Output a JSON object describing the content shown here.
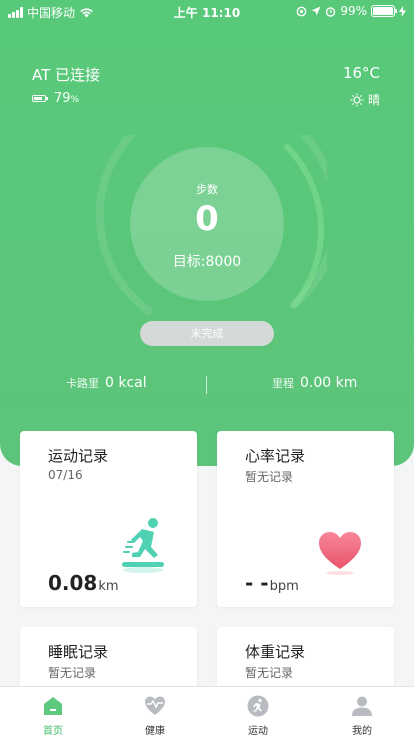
{
  "status_bar": {
    "carrier": "中国移动",
    "time": "上午 11:10",
    "battery_percent": "99%",
    "battery_level": 0.99,
    "icons": [
      "signal-icon",
      "wifi-icon",
      "location-icon",
      "navigation-icon",
      "alarm-icon",
      "battery-icon",
      "charging-icon"
    ]
  },
  "header": {
    "connection_status": "AT 已连接",
    "temperature": "16°C",
    "device_battery_value": "79",
    "device_battery_unit": "%",
    "device_battery_level": 0.79,
    "weather": "晴"
  },
  "steps": {
    "label": "步数",
    "value": "0",
    "goal_text": "目标:8000",
    "status_button": "未完成"
  },
  "stats": {
    "calories_label": "卡路里",
    "calories_value": "0 kcal",
    "distance_label": "里程",
    "distance_value": "0.00 km"
  },
  "cards": {
    "exercise": {
      "title": "运动记录",
      "subtitle": "07/16",
      "value": "0.08",
      "unit": "km"
    },
    "heart_rate": {
      "title": "心率记录",
      "subtitle": "暂无记录",
      "value": "- -",
      "unit": "bpm"
    },
    "sleep": {
      "title": "睡眠记录",
      "subtitle": "暂无记录"
    },
    "weight": {
      "title": "体重记录",
      "subtitle": "暂无记录"
    }
  },
  "tab_bar": {
    "home": "首页",
    "health": "健康",
    "sport": "运动",
    "mine": "我的"
  },
  "colors": {
    "primary_green": "#58c979",
    "active_tab": "#3fbf6b",
    "heart": "#f0667a",
    "runner_icon": "#4fd2b4"
  }
}
